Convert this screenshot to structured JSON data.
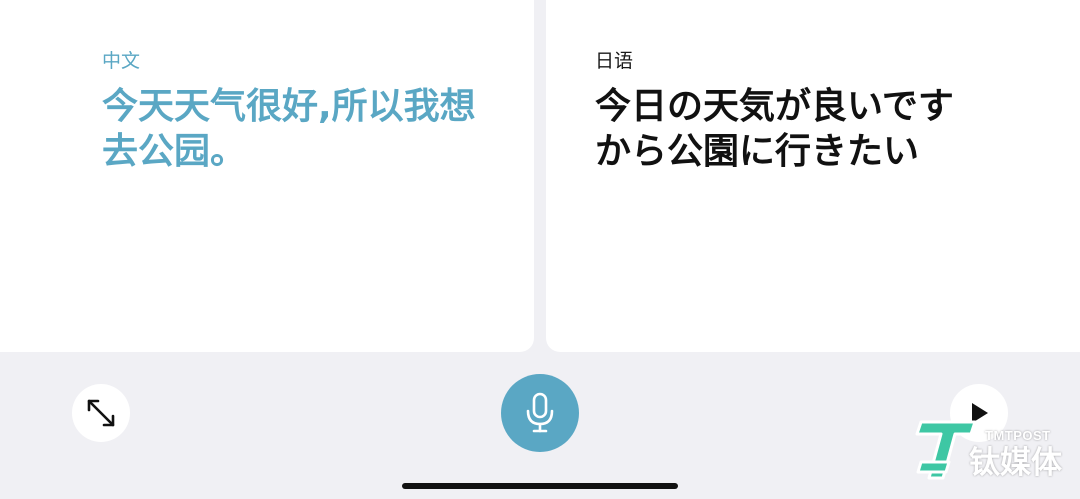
{
  "source": {
    "language_label": "中文",
    "text": "今天天气很好,所以我想去公园。"
  },
  "target": {
    "language_label": "日语",
    "text": "今日の天気が良いですから公園に行きたい"
  },
  "controls": {
    "expand_icon": "expand-arrows-icon",
    "mic_icon": "microphone-icon",
    "play_icon": "play-icon"
  },
  "watermark": {
    "small_text": "TMTPOST",
    "big_text": "钛媒体"
  },
  "colors": {
    "accent": "#5aa7c4",
    "panel_background": "#ffffff",
    "page_background": "#f0f0f4",
    "target_text": "#111111"
  }
}
